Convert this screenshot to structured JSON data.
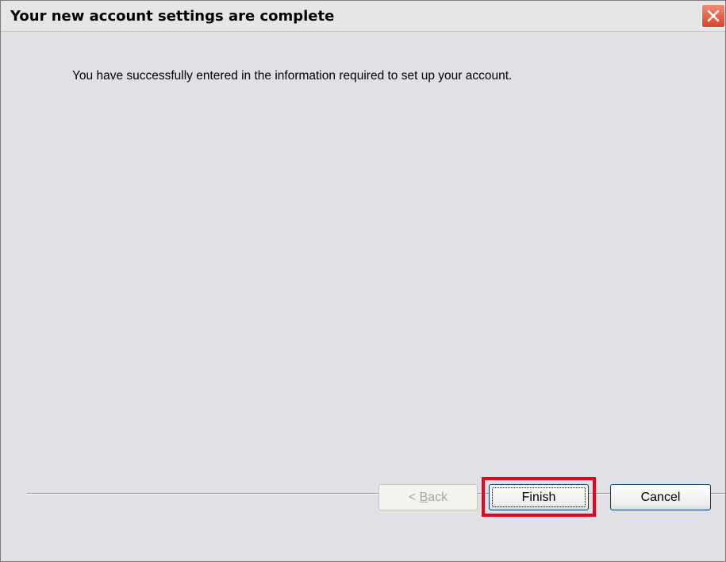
{
  "window": {
    "title": "Your new account settings are complete"
  },
  "content": {
    "message": "You have successfully entered in the information required to set up your account."
  },
  "buttons": {
    "back_accel": "B",
    "back_rest": "ack",
    "back_prefix": "< ",
    "finish_label": "Finish",
    "cancel_label": "Cancel"
  },
  "colors": {
    "highlight": "#e8001c",
    "close_button": "#d9432a"
  },
  "icons": {
    "close": "close-icon"
  }
}
